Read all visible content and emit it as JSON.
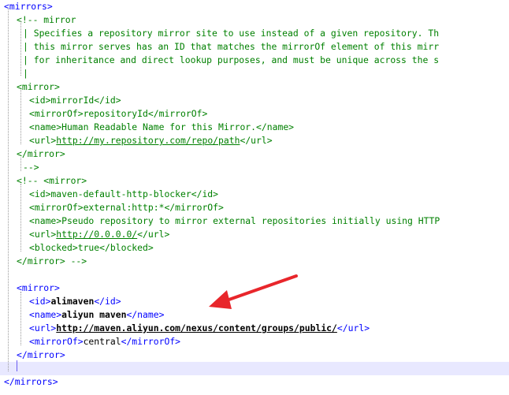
{
  "editor": {
    "lines": [
      [
        {
          "c": "tag",
          "t": "<mirrors>"
        }
      ],
      [
        {
          "c": "cm",
          "t": "<!-- mirror"
        }
      ],
      [
        {
          "c": "cm",
          "t": "| Specifies a repository mirror site to use instead of a given repository. Th"
        }
      ],
      [
        {
          "c": "cm",
          "t": "| this mirror serves has an ID that matches the mirrorOf element of this mirr"
        }
      ],
      [
        {
          "c": "cm",
          "t": "| for inheritance and direct lookup purposes, and must be unique across the s"
        }
      ],
      [
        {
          "c": "cm",
          "t": "|"
        }
      ],
      [
        {
          "c": "cm",
          "t": "<mirror>"
        }
      ],
      [
        {
          "c": "cm",
          "t": "<id>mirrorId</id>"
        }
      ],
      [
        {
          "c": "cm",
          "t": "<mirrorOf>repositoryId</mirrorOf>"
        }
      ],
      [
        {
          "c": "cm",
          "t": "<name>Human Readable Name for this Mirror.</name>"
        }
      ],
      [
        {
          "c": "cm",
          "t": "<url>"
        },
        {
          "c": "cm url",
          "t": "http://my.repository.com/repo/path"
        },
        {
          "c": "cm",
          "t": "</url>"
        }
      ],
      [
        {
          "c": "cm",
          "t": "</mirror>"
        }
      ],
      [
        {
          "c": "cm",
          "t": "-->"
        }
      ],
      [
        {
          "c": "cm",
          "t": "<!-- <mirror>"
        }
      ],
      [
        {
          "c": "cm",
          "t": "<id>maven-default-http-blocker</id>"
        }
      ],
      [
        {
          "c": "cm",
          "t": "<mirrorOf>external:http:*</mirrorOf>"
        }
      ],
      [
        {
          "c": "cm",
          "t": "<name>Pseudo repository to mirror external repositories initially using HTTP"
        }
      ],
      [
        {
          "c": "cm",
          "t": "<url>"
        },
        {
          "c": "cm url",
          "t": "http://0.0.0.0/"
        },
        {
          "c": "cm",
          "t": "</url>"
        }
      ],
      [
        {
          "c": "cm",
          "t": "<blocked>true</blocked>"
        }
      ],
      [
        {
          "c": "cm",
          "t": "</mirror> -->"
        }
      ],
      [],
      [
        {
          "c": "tag",
          "t": "<mirror>"
        }
      ],
      [
        {
          "c": "tag",
          "t": "<id>"
        },
        {
          "c": "tx b",
          "t": "alimaven"
        },
        {
          "c": "tag",
          "t": "</id>"
        }
      ],
      [
        {
          "c": "tag",
          "t": "<name>"
        },
        {
          "c": "tx b",
          "t": "aliyun maven"
        },
        {
          "c": "tag",
          "t": "</name>"
        }
      ],
      [
        {
          "c": "tag",
          "t": "<url>"
        },
        {
          "c": "tx b url",
          "t": "http://maven.aliyun.com/nexus/content/groups/public/"
        },
        {
          "c": "tag",
          "t": "</url>"
        }
      ],
      [
        {
          "c": "tag",
          "t": "<mirrorOf>"
        },
        {
          "c": "tx",
          "t": "central"
        },
        {
          "c": "tag",
          "t": "</mirrorOf>"
        }
      ],
      [
        {
          "c": "tag",
          "t": "</mirror>"
        }
      ],
      [],
      [
        {
          "c": "tag",
          "t": "</mirrors>"
        }
      ]
    ],
    "current_line": 27,
    "arrow_color": "#e8262b"
  }
}
